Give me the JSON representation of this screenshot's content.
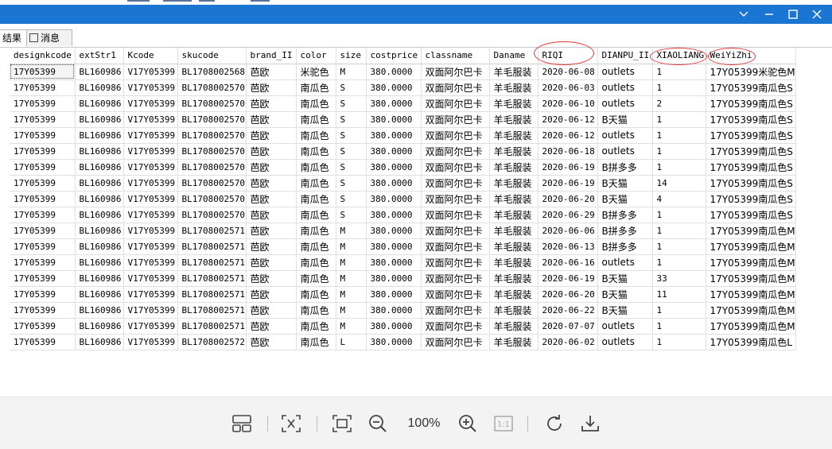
{
  "tabs": [
    {
      "label": "结果"
    },
    {
      "label": "消息"
    }
  ],
  "grid": {
    "columns": [
      "designkcode",
      "extStr1",
      "Kcode",
      "skucode",
      "brand_II",
      "color",
      "size",
      "costprice",
      "classname",
      "Daname",
      "RIQI",
      "DIANPU_II",
      "XIAOLIANG",
      "WeiYiZhi"
    ],
    "rows": [
      [
        "17Y05399",
        "BL160986",
        "V17Y05399",
        "BL1708002568",
        "芭欧",
        "米驼色",
        "M",
        "380.0000",
        "双面阿尔巴卡",
        "羊毛服装",
        "2020-06-08",
        "outlets",
        "1",
        "17Y05399米驼色M"
      ],
      [
        "17Y05399",
        "BL160986",
        "V17Y05399",
        "BL1708002570",
        "芭欧",
        "南瓜色",
        "S",
        "380.0000",
        "双面阿尔巴卡",
        "羊毛服装",
        "2020-06-03",
        "outlets",
        "1",
        "17Y05399南瓜色S"
      ],
      [
        "17Y05399",
        "BL160986",
        "V17Y05399",
        "BL1708002570",
        "芭欧",
        "南瓜色",
        "S",
        "380.0000",
        "双面阿尔巴卡",
        "羊毛服装",
        "2020-06-10",
        "outlets",
        "2",
        "17Y05399南瓜色S"
      ],
      [
        "17Y05399",
        "BL160986",
        "V17Y05399",
        "BL1708002570",
        "芭欧",
        "南瓜色",
        "S",
        "380.0000",
        "双面阿尔巴卡",
        "羊毛服装",
        "2020-06-12",
        "B天猫",
        "1",
        "17Y05399南瓜色S"
      ],
      [
        "17Y05399",
        "BL160986",
        "V17Y05399",
        "BL1708002570",
        "芭欧",
        "南瓜色",
        "S",
        "380.0000",
        "双面阿尔巴卡",
        "羊毛服装",
        "2020-06-12",
        "outlets",
        "1",
        "17Y05399南瓜色S"
      ],
      [
        "17Y05399",
        "BL160986",
        "V17Y05399",
        "BL1708002570",
        "芭欧",
        "南瓜色",
        "S",
        "380.0000",
        "双面阿尔巴卡",
        "羊毛服装",
        "2020-06-18",
        "outlets",
        "1",
        "17Y05399南瓜色S"
      ],
      [
        "17Y05399",
        "BL160986",
        "V17Y05399",
        "BL1708002570",
        "芭欧",
        "南瓜色",
        "S",
        "380.0000",
        "双面阿尔巴卡",
        "羊毛服装",
        "2020-06-19",
        "B拼多多",
        "1",
        "17Y05399南瓜色S"
      ],
      [
        "17Y05399",
        "BL160986",
        "V17Y05399",
        "BL1708002570",
        "芭欧",
        "南瓜色",
        "S",
        "380.0000",
        "双面阿尔巴卡",
        "羊毛服装",
        "2020-06-19",
        "B天猫",
        "14",
        "17Y05399南瓜色S"
      ],
      [
        "17Y05399",
        "BL160986",
        "V17Y05399",
        "BL1708002570",
        "芭欧",
        "南瓜色",
        "S",
        "380.0000",
        "双面阿尔巴卡",
        "羊毛服装",
        "2020-06-20",
        "B天猫",
        "4",
        "17Y05399南瓜色S"
      ],
      [
        "17Y05399",
        "BL160986",
        "V17Y05399",
        "BL1708002570",
        "芭欧",
        "南瓜色",
        "S",
        "380.0000",
        "双面阿尔巴卡",
        "羊毛服装",
        "2020-06-29",
        "B拼多多",
        "1",
        "17Y05399南瓜色S"
      ],
      [
        "17Y05399",
        "BL160986",
        "V17Y05399",
        "BL1708002571",
        "芭欧",
        "南瓜色",
        "M",
        "380.0000",
        "双面阿尔巴卡",
        "羊毛服装",
        "2020-06-06",
        "B拼多多",
        "1",
        "17Y05399南瓜色M"
      ],
      [
        "17Y05399",
        "BL160986",
        "V17Y05399",
        "BL1708002571",
        "芭欧",
        "南瓜色",
        "M",
        "380.0000",
        "双面阿尔巴卡",
        "羊毛服装",
        "2020-06-13",
        "B拼多多",
        "1",
        "17Y05399南瓜色M"
      ],
      [
        "17Y05399",
        "BL160986",
        "V17Y05399",
        "BL1708002571",
        "芭欧",
        "南瓜色",
        "M",
        "380.0000",
        "双面阿尔巴卡",
        "羊毛服装",
        "2020-06-16",
        "outlets",
        "1",
        "17Y05399南瓜色M"
      ],
      [
        "17Y05399",
        "BL160986",
        "V17Y05399",
        "BL1708002571",
        "芭欧",
        "南瓜色",
        "M",
        "380.0000",
        "双面阿尔巴卡",
        "羊毛服装",
        "2020-06-19",
        "B天猫",
        "33",
        "17Y05399南瓜色M"
      ],
      [
        "17Y05399",
        "BL160986",
        "V17Y05399",
        "BL1708002571",
        "芭欧",
        "南瓜色",
        "M",
        "380.0000",
        "双面阿尔巴卡",
        "羊毛服装",
        "2020-06-20",
        "B天猫",
        "11",
        "17Y05399南瓜色M"
      ],
      [
        "17Y05399",
        "BL160986",
        "V17Y05399",
        "BL1708002571",
        "芭欧",
        "南瓜色",
        "M",
        "380.0000",
        "双面阿尔巴卡",
        "羊毛服装",
        "2020-06-22",
        "B天猫",
        "1",
        "17Y05399南瓜色M"
      ],
      [
        "17Y05399",
        "BL160986",
        "V17Y05399",
        "BL1708002571",
        "芭欧",
        "南瓜色",
        "M",
        "380.0000",
        "双面阿尔巴卡",
        "羊毛服装",
        "2020-07-07",
        "outlets",
        "1",
        "17Y05399南瓜色M"
      ],
      [
        "17Y05399",
        "BL160986",
        "V17Y05399",
        "BL1708002572",
        "芭欧",
        "南瓜色",
        "L",
        "380.0000",
        "双面阿尔巴卡",
        "羊毛服装",
        "2020-06-02",
        "outlets",
        "1",
        "17Y05399南瓜色L"
      ]
    ]
  },
  "viewer": {
    "zoom": "100%",
    "icons": [
      "layout-icon",
      "crop-icon",
      "fit-screen-icon",
      "zoom-out-icon",
      "zoom-in-icon",
      "actual-size-icon",
      "rotate-icon",
      "download-icon"
    ]
  },
  "colors": {
    "titlebar": "#1a76d2",
    "annotation": "#e23a3a"
  }
}
